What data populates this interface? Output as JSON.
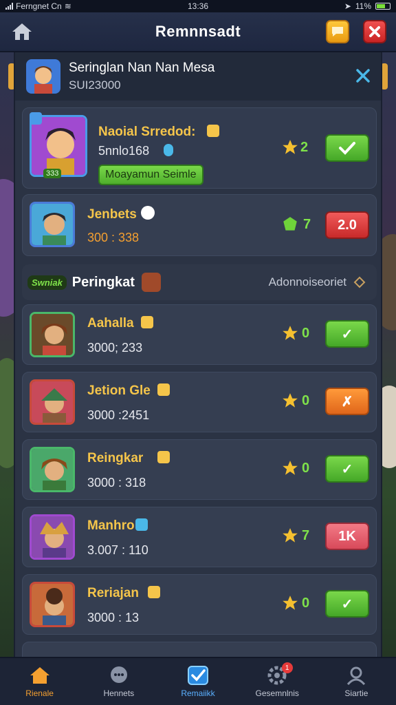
{
  "status_bar": {
    "carrier": "Ferngnet Cn",
    "time": "13:36",
    "battery": "11%"
  },
  "top_bar": {
    "title": "Remnnsadt"
  },
  "header_card": {
    "name": "Seringlan Nan Nan Mesa",
    "sub": "SUI23000"
  },
  "featured": {
    "name": "Naoial Srredod:",
    "score": "5nnlo168",
    "level": "333",
    "action_label": "Moayamun Seimle",
    "stars": "2"
  },
  "second": {
    "name": "Jenbets",
    "score": "300 : 338",
    "count": "7",
    "button": "2.0"
  },
  "section": {
    "logo": "Swniak",
    "label": "Peringkat",
    "right_label": "Adonnoiseoriet"
  },
  "entries": [
    {
      "name": "Aahalla",
      "score": "3000; 233",
      "count": "0",
      "button": "✓",
      "style": "green"
    },
    {
      "name": "Jetion Gle",
      "score": "3000 :2451",
      "count": "0",
      "button": "✗",
      "style": "orange"
    },
    {
      "name": "Reingkar",
      "score": "3000 : 318",
      "count": "0",
      "button": "✓",
      "style": "green"
    },
    {
      "name": "Manhro",
      "score": "3.007 : 110",
      "count": "7",
      "button": "1K",
      "style": "pink"
    },
    {
      "name": "Reriajan",
      "score": "3000 : 13",
      "count": "0",
      "button": "✓",
      "style": "green"
    }
  ],
  "bottom_nav": [
    {
      "label": "Rienale",
      "icon": "home-icon"
    },
    {
      "label": "Hennets",
      "icon": "chat-bubble-icon"
    },
    {
      "label": "Remaiikk",
      "icon": "checkbox-icon"
    },
    {
      "label": "Gesemnlnis",
      "icon": "gear-icon",
      "badge": "1"
    },
    {
      "label": "Siartie",
      "icon": "profile-icon"
    }
  ],
  "colors": {
    "accent": "#f5c54a",
    "green": "#7fe24a",
    "panel": "#2b3344"
  }
}
